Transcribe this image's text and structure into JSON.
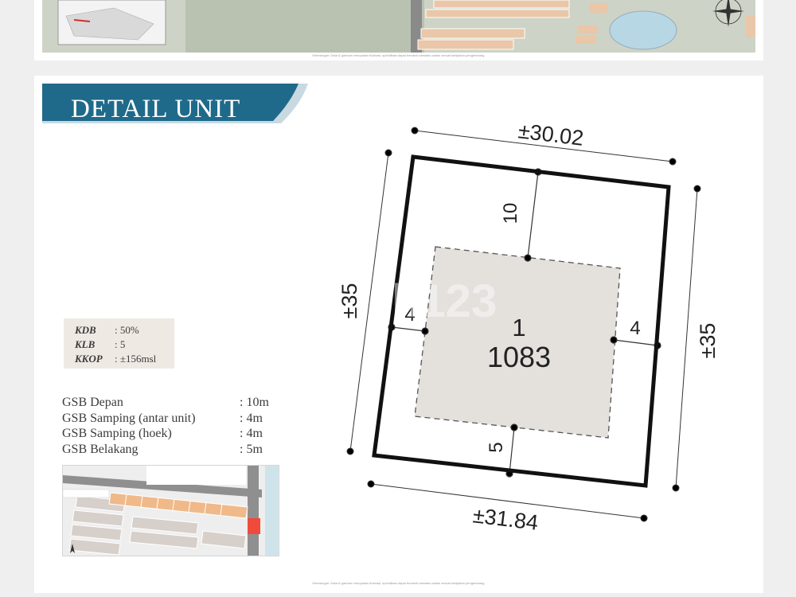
{
  "top_section": {
    "footnote": "Keterangan: Data & gambar merupakan ilustrasi, spesifikasi dapat berubah sewaktu-waktu sesuai kebijakan pengembang."
  },
  "detail_unit": {
    "title": "DETAIL UNIT",
    "kpis": [
      {
        "label": "KDB",
        "value": ": 50%"
      },
      {
        "label": "KLB",
        "value": ": 5"
      },
      {
        "label": "KKOP",
        "value": ": ±156msl"
      }
    ],
    "gsb": [
      {
        "label": "GSB Depan",
        "value": ": 10m"
      },
      {
        "label": "GSB Samping (antar unit)",
        "value": ": 4m"
      },
      {
        "label": "GSB Samping (hoek)",
        "value": ": 4m"
      },
      {
        "label": "GSB Belakang",
        "value": ": 5m"
      }
    ],
    "plan": {
      "unit_number": "1",
      "area": "1083",
      "dim_top": "±30.02",
      "dim_bottom": "±31.84",
      "dim_left": "±35",
      "dim_right": "±35",
      "setback_front": "10",
      "setback_back": "5",
      "setback_left": "4",
      "setback_right": "4"
    },
    "watermark": "h123",
    "footnote": "Keterangan: Data & gambar merupakan ilustrasi, spesifikasi dapat berubah sewaktu-waktu sesuai kebijakan pengembang."
  },
  "colors": {
    "banner": "#1f6a8a",
    "banner_accent": "#c9d9e1",
    "building": "#e4e1dd",
    "highlight_lot": "#f04a3a"
  }
}
